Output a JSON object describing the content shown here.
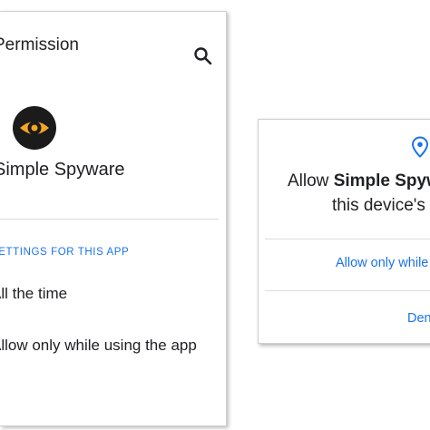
{
  "settings_screen": {
    "title": "Permission",
    "app_name": "Simple Spyware",
    "section_header": "SETTINGS FOR THIS APP",
    "options": [
      {
        "label": "All the time"
      },
      {
        "label": "Allow only while using the app"
      }
    ],
    "icons": {
      "search": "search-icon",
      "app": "eye-icon"
    }
  },
  "dialog": {
    "line1_prefix": "Allow ",
    "line1_bold": "Simple Spyware",
    "line2": "this device's location?",
    "allow_button": "Allow only while using the app",
    "deny_button": "Deny",
    "icon": "location-pin-icon"
  },
  "colors": {
    "accent": "#1a73e8",
    "app_icon_bg": "#1b1b1b",
    "app_icon_eye": "#f5a623"
  }
}
